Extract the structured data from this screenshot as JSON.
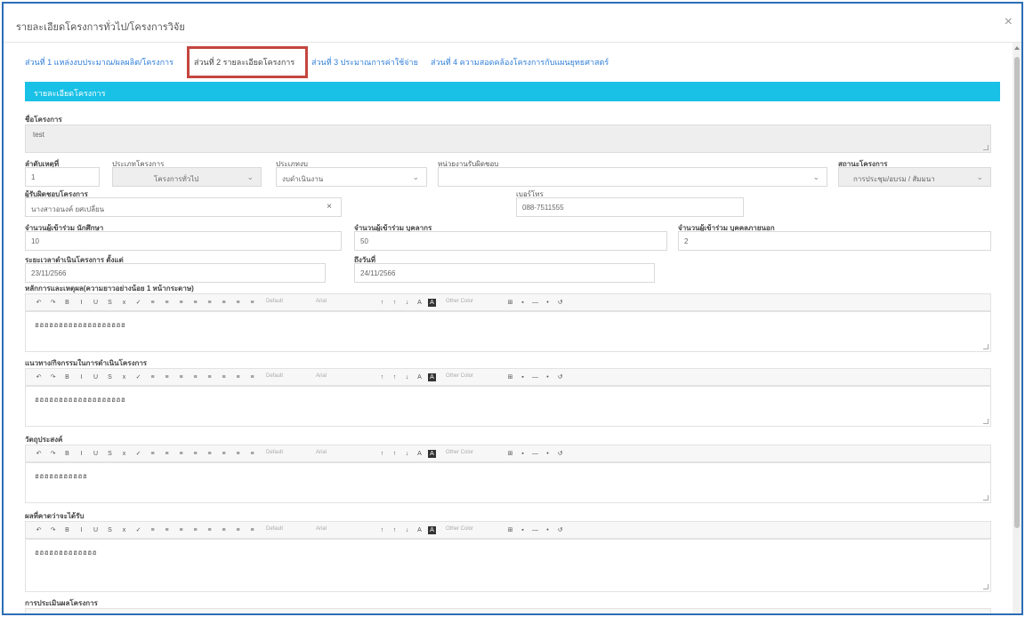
{
  "modal": {
    "title": "รายละเอียดโครงการทั่วไป/โครงการวิจัย",
    "close_label": "×"
  },
  "tabs": [
    {
      "label": "ส่วนที่ 1 แหล่งงบประมาณ/ผลผลิต/โครงการ"
    },
    {
      "label": "ส่วนที่ 2 รายละเอียดโครงการ"
    },
    {
      "label": "ส่วนที่ 3 ประมาณการค่าใช้จ่าย"
    },
    {
      "label": "ส่วนที่ 4 ความสอดคล้องโครงการกับแผนยุทธศาสตร์"
    }
  ],
  "section": {
    "title": "รายละเอียดโครงการ"
  },
  "form": {
    "project_name_label": "ชื่อโครงการ",
    "project_name_value": "test",
    "order_label": "ลำดับเหตุที่",
    "order_value": "1",
    "project_type_label": "ประเภทโครงการ",
    "project_type_value": "โครงการทั่วไป",
    "category_label": "ประเภทงบ",
    "category_value": "งบดำเนินงาน",
    "unit_label": "หน่วยงานรับผิดชอบ",
    "unit_value": "",
    "status_label": "สถานะโครงการ",
    "status_value": "การประชุม/อบรม / สัมมนา",
    "owner_label": "ผู้รับผิดชอบโครงการ",
    "owner_value": "นางสาวอนงค์ ยศเปลี่ยน",
    "phone_label": "เบอร์โทร",
    "phone_value": "088-7511555",
    "students_label": "จำนวนผู้เข้าร่วม นักศึกษา",
    "students_value": "10",
    "staff_label": "จำนวนผู้เข้าร่วม บุคลากร",
    "staff_value": "50",
    "external_label": "จำนวนผู้เข้าร่วม บุคคลภายนอก",
    "external_value": "2",
    "start_label": "ระยะเวลาดำเนินโครงการ ตั้งแต่",
    "start_value": "23/11/2566",
    "end_label": "ถึงวันที่",
    "end_value": "24/11/2566"
  },
  "editors": [
    {
      "label": "หลักการและเหตุผล(ความยาวอย่างน้อย 1 หน้ากระดาษ)",
      "value": "ฮฮฮฮฮฮฮฮฮฮฮฮฮฮฮฮฮฮฮ"
    },
    {
      "label": "แนวทาง/กิจกรรมในการดำเนินโครงการ",
      "value": "ฮฮฮฮฮฮฮฮฮฮฮฮฮฮฮฮฮฮฮ"
    },
    {
      "label": "วัตถุประสงค์",
      "value": "ฮฮฮฮฮฮฮฮฮฮฮ"
    },
    {
      "label": "ผลที่คาดว่าจะได้รับ",
      "value": "ฮฮฮฮฮฮฮฮฮฮฮฮฮ"
    },
    {
      "label": "การประเมินผลโครงการ",
      "value": ""
    }
  ],
  "toolbar": {
    "font_name": "Default",
    "font_size": "Arial",
    "color_label": "Other Color"
  },
  "colors": {
    "accent": "#19c1e6",
    "tab_highlight": "#c4463f",
    "frame": "#2d6db5"
  }
}
